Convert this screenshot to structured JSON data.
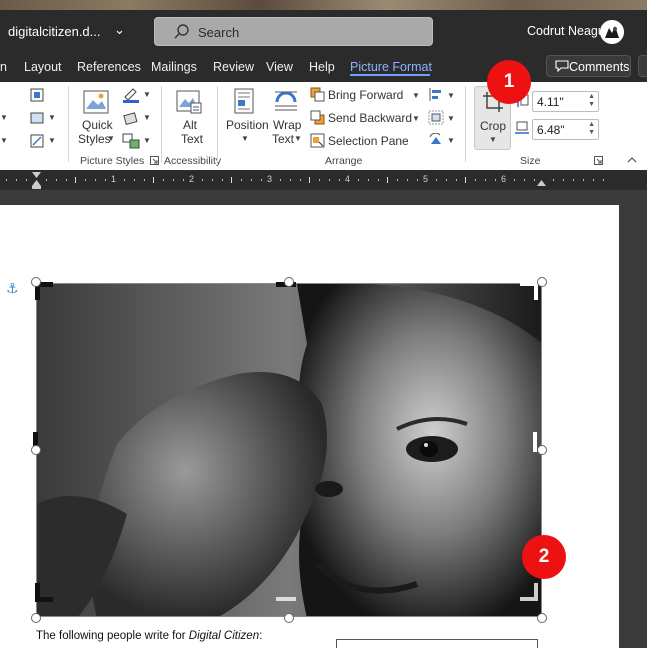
{
  "titlebar": {
    "document_title": "digitalcitizen.d...",
    "search_placeholder": "Search",
    "user_name": "Codrut Neagu"
  },
  "tabs": [
    {
      "label": "n"
    },
    {
      "label": "Layout"
    },
    {
      "label": "References"
    },
    {
      "label": "Mailings"
    },
    {
      "label": "Review"
    },
    {
      "label": "View"
    },
    {
      "label": "Help"
    },
    {
      "label": "Picture Format",
      "active": true
    }
  ],
  "comments_label": "Comments",
  "ribbon": {
    "picture_styles": {
      "quick_styles": [
        "Quick",
        "Styles"
      ],
      "group_label": "Picture Styles"
    },
    "accessibility": {
      "alt_text": [
        "Alt",
        "Text"
      ],
      "group_label": "Accessibility"
    },
    "arrange": {
      "position": "Position",
      "wrap_text": [
        "Wrap",
        "Text"
      ],
      "bring_forward": "Bring Forward",
      "send_backward": "Send Backward",
      "selection_pane": "Selection Pane",
      "group_label": "Arrange"
    },
    "size": {
      "crop": "Crop",
      "height": "4.11\"",
      "width": "6.48\"",
      "group_label": "Size"
    }
  },
  "ruler_numbers": [
    "1",
    "2",
    "3",
    "4",
    "5",
    "6"
  ],
  "caption": {
    "prefix": "The following people write for ",
    "italic": "Digital Citizen",
    "suffix": ":"
  },
  "badges": [
    "1",
    "2"
  ],
  "colors": {
    "titlebar": "#2b2b2b",
    "accent_tab": "#8cb4ff",
    "badge": "#ee1111",
    "anchor": "#2f8ed8"
  }
}
